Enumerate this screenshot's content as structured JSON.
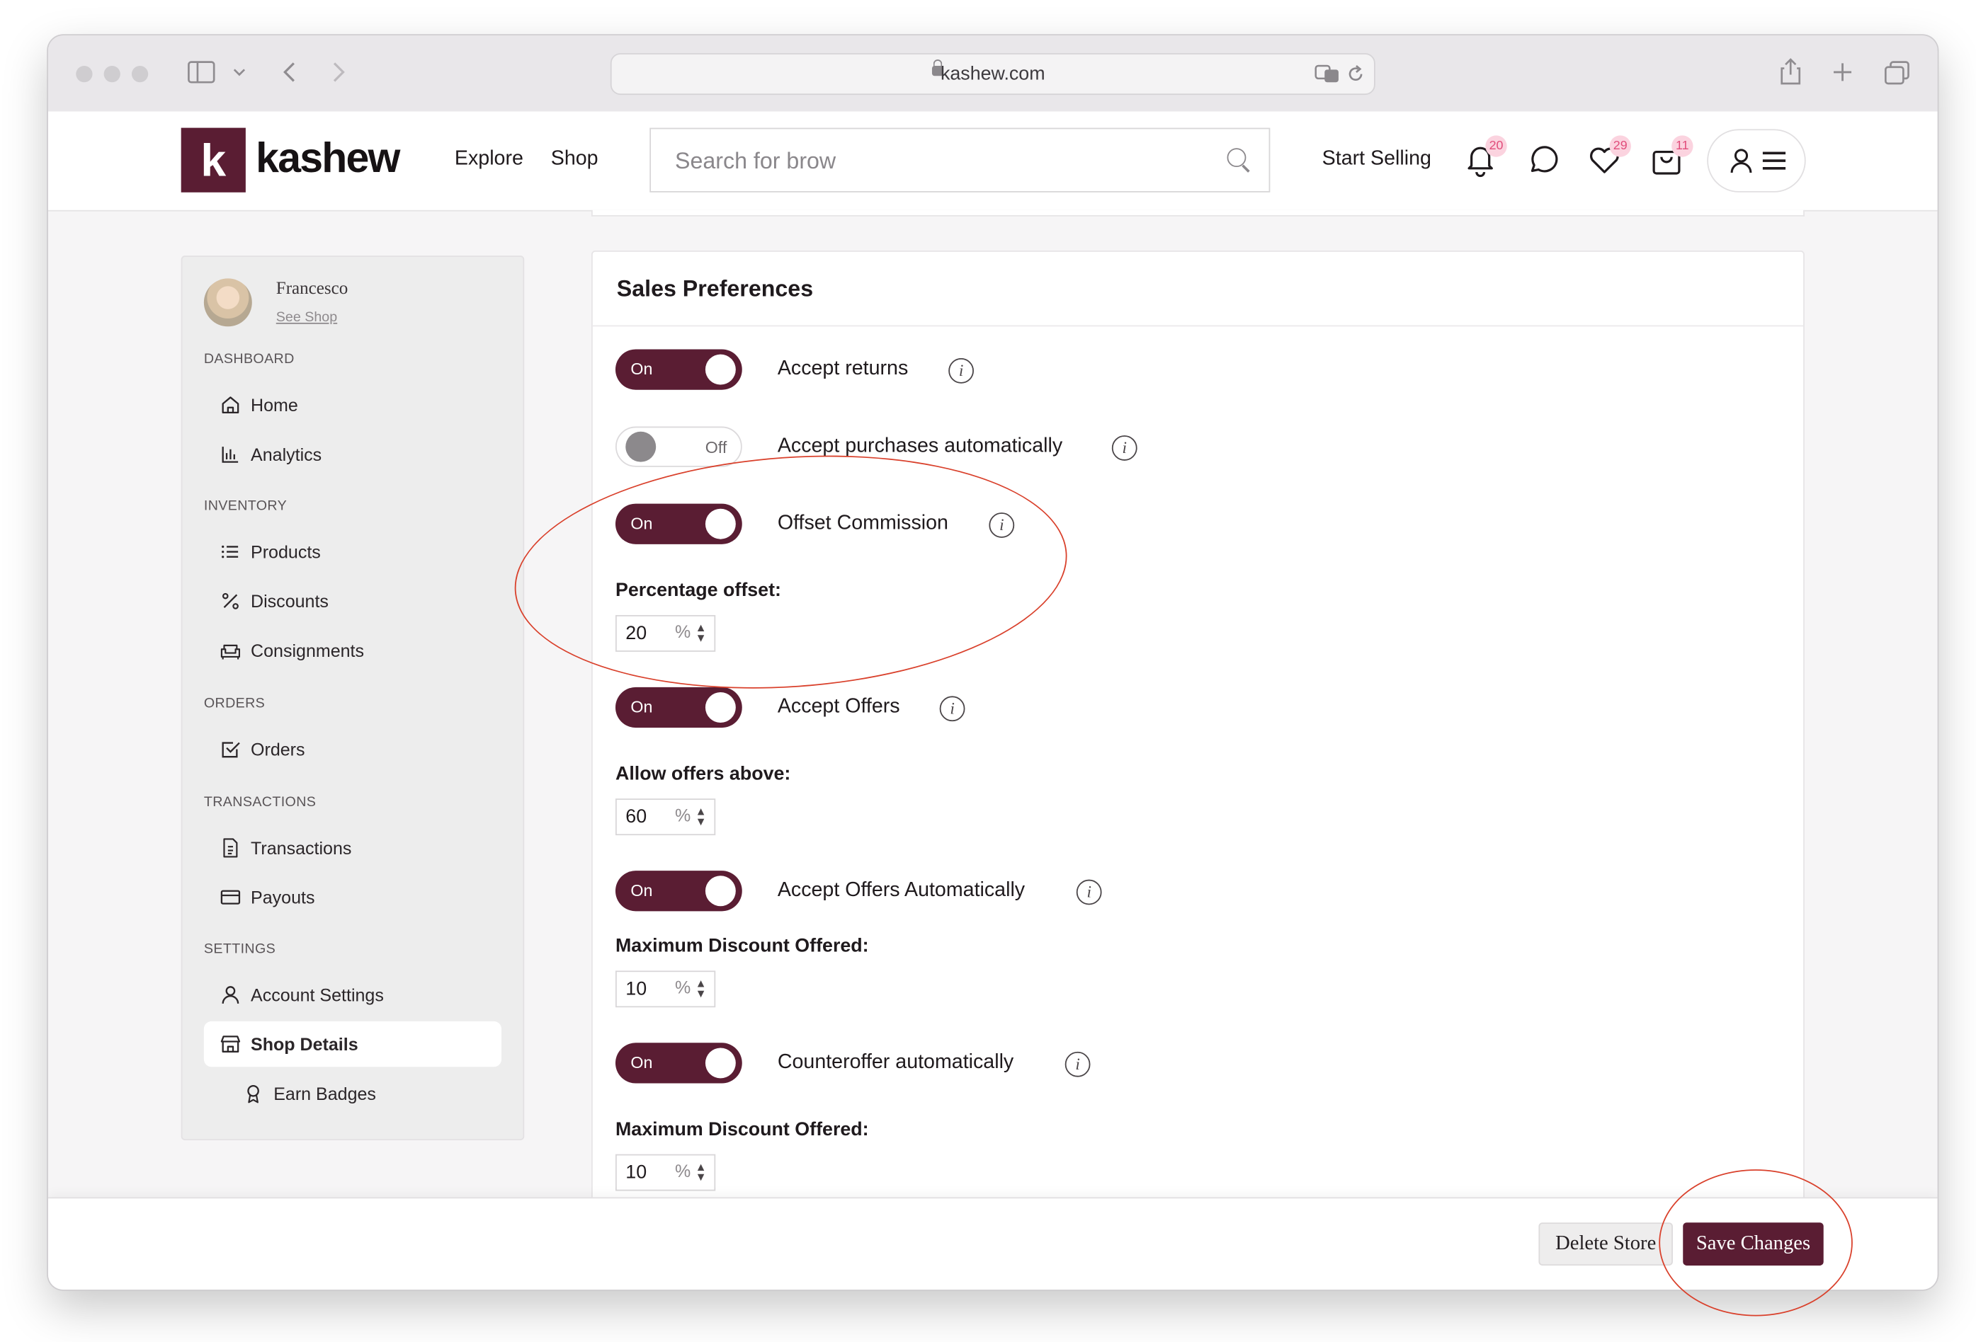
{
  "browser": {
    "url": "kashew.com"
  },
  "header": {
    "logo_mark": "k",
    "logo_text": "kashew",
    "nav": [
      "Explore",
      "Shop"
    ],
    "search_placeholder": "Search for brow",
    "start_selling": "Start Selling",
    "badges": {
      "notifications": "20",
      "favorites": "29",
      "cart": "11"
    }
  },
  "sidebar": {
    "user_name": "Francesco",
    "see_shop": "See Shop",
    "sections": {
      "dashboard": "DASHBOARD",
      "inventory": "INVENTORY",
      "orders": "ORDERS",
      "transactions": "TRANSACTIONS",
      "settings": "SETTINGS"
    },
    "items": {
      "home": "Home",
      "analytics": "Analytics",
      "products": "Products",
      "discounts": "Discounts",
      "consignments": "Consignments",
      "orders": "Orders",
      "transactions": "Transactions",
      "payouts": "Payouts",
      "account_settings": "Account Settings",
      "shop_details": "Shop Details",
      "earn_badges": "Earn Badges"
    }
  },
  "panel": {
    "title": "Sales Preferences",
    "toggle_on": "On",
    "toggle_off": "Off",
    "info_glyph": "i",
    "pct": "%",
    "rows": {
      "accept_returns": "Accept returns",
      "accept_purchases": "Accept purchases automatically",
      "offset_commission": "Offset Commission",
      "accept_offers": "Accept Offers",
      "accept_offers_auto": "Accept Offers Automatically",
      "counteroffer_auto": "Counteroffer automatically"
    },
    "fields": {
      "percentage_offset": {
        "label": "Percentage offset:",
        "value": "20"
      },
      "allow_offers_above": {
        "label": "Allow offers above:",
        "value": "60"
      },
      "max_discount_1": {
        "label": "Maximum Discount Offered:",
        "value": "10"
      },
      "max_discount_2": {
        "label": "Maximum Discount Offered:",
        "value": "10"
      }
    }
  },
  "footer": {
    "delete": "Delete Store",
    "save": "Save Changes"
  },
  "colors": {
    "brand": "#5a1d33",
    "annotation": "#d9402b",
    "badge_text": "#e14d7b"
  }
}
